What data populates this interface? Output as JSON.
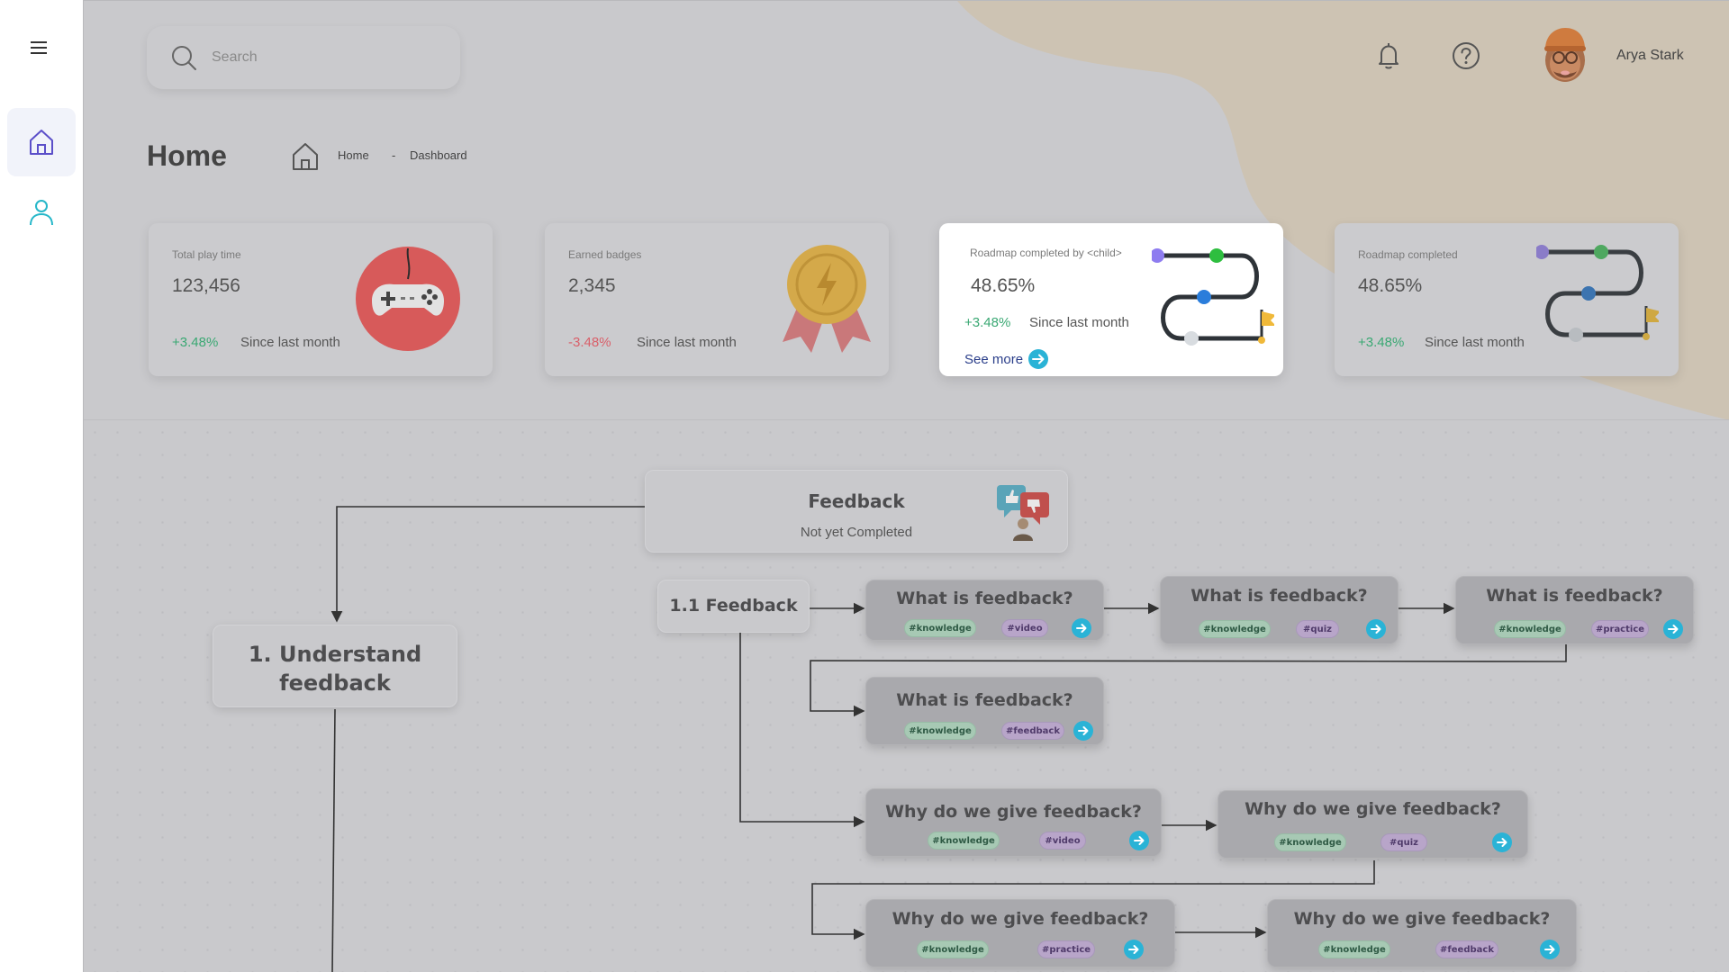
{
  "header": {
    "search_placeholder": "Search",
    "user_name": "Arya Stark"
  },
  "page": {
    "title": "Home",
    "breadcrumb": {
      "home": "Home",
      "separator": "-",
      "current": "Dashboard"
    }
  },
  "stats": [
    {
      "label": "Total play time",
      "value": "123,456",
      "change": "+3.48%",
      "change_type": "positive",
      "since": "Since last month",
      "icon": "gamepad-icon"
    },
    {
      "label": "Earned badges",
      "value": "2,345",
      "change": "-3.48%",
      "change_type": "negative",
      "since": "Since last month",
      "icon": "medal-icon"
    },
    {
      "label": "Roadmap completed by <child>",
      "value": "48.65%",
      "change": "+3.48%",
      "change_type": "positive",
      "since": "Since last month",
      "link": "See more",
      "icon": "roadmap-icon"
    },
    {
      "label": "Roadmap completed",
      "value": "48.65%",
      "change": "+3.48%",
      "change_type": "positive",
      "since": "Since last month",
      "icon": "roadmap-icon"
    }
  ],
  "roadmap": {
    "root": {
      "title": "Feedback",
      "status": "Not yet Completed"
    },
    "chapter": {
      "title_line1": "1. Understand",
      "title_line2": "feedback"
    },
    "section": {
      "title": "1.1 Feedback"
    },
    "lessons": [
      {
        "title": "What is feedback?",
        "tags": [
          "#knowledge",
          "#video"
        ]
      },
      {
        "title": "What is feedback?",
        "tags": [
          "#knowledge",
          "#quiz"
        ]
      },
      {
        "title": "What is feedback?",
        "tags": [
          "#knowledge",
          "#practice"
        ]
      },
      {
        "title": "What is feedback?",
        "tags": [
          "#knowledge",
          "#feedback"
        ]
      },
      {
        "title": "Why do we give feedback?",
        "tags": [
          "#knowledge",
          "#video"
        ]
      },
      {
        "title": "Why do we give feedback?",
        "tags": [
          "#knowledge",
          "#quiz"
        ]
      },
      {
        "title": "Why do we give feedback?",
        "tags": [
          "#knowledge",
          "#practice"
        ]
      },
      {
        "title": "Why do we give feedback?",
        "tags": [
          "#knowledge",
          "#feedback"
        ]
      }
    ]
  },
  "colors": {
    "overlay": "#c9c9cc",
    "accent_blob": "#cdc3b3",
    "positive": "#3aa873",
    "negative": "#d9606a",
    "go_button": "#2ab3d6",
    "tag_knowledge": "#a7c9b4",
    "tag_type": "#b8a5c9"
  }
}
